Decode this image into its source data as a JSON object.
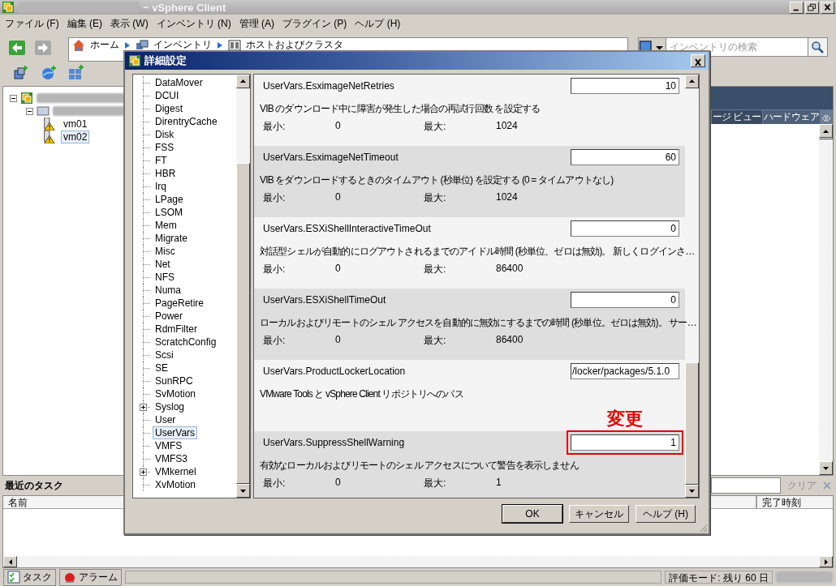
{
  "window": {
    "title": "~ vSphere Client"
  },
  "menu": [
    "ファイル (F)",
    "編集 (E)",
    "表示 (W)",
    "インベントリ (N)",
    "管理 (A)",
    "プラグイン (P)",
    "ヘルプ (H)"
  ],
  "breadcrumb": [
    "ホーム",
    "インベントリ",
    "ホストおよびクラスタ"
  ],
  "search": {
    "placeholder": "インベントリの検索"
  },
  "inventory_tree": [
    {
      "kind": "datacenter",
      "expanded": true,
      "children": [
        {
          "kind": "host",
          "expanded": true,
          "children": [
            {
              "kind": "vm",
              "label": "vm01",
              "selected": false
            },
            {
              "kind": "vm",
              "label": "vm02",
              "selected": true
            }
          ]
        }
      ]
    }
  ],
  "tabs": [
    {
      "label": "ージ ビュー",
      "selected": true
    },
    {
      "label": "ハードウェア",
      "selected": false
    }
  ],
  "recent_tasks": {
    "title": "最近のタスク",
    "clear": "クリア",
    "columns": [
      "名前",
      "完了時刻"
    ]
  },
  "status_bar": {
    "tabs": [
      "タスク",
      "アラーム"
    ],
    "mode": "評価モード: 残り 60 日"
  },
  "dialog": {
    "title": "詳細設定",
    "categories": [
      {
        "label": "DataMover",
        "kind": "leaf",
        "selected": false
      },
      {
        "label": "DCUI",
        "kind": "leaf",
        "selected": false
      },
      {
        "label": "Digest",
        "kind": "leaf",
        "selected": false
      },
      {
        "label": "DirentryCache",
        "kind": "leaf",
        "selected": false
      },
      {
        "label": "Disk",
        "kind": "leaf",
        "selected": false
      },
      {
        "label": "FSS",
        "kind": "leaf",
        "selected": false
      },
      {
        "label": "FT",
        "kind": "leaf",
        "selected": false
      },
      {
        "label": "HBR",
        "kind": "leaf",
        "selected": false
      },
      {
        "label": "Irq",
        "kind": "leaf",
        "selected": false
      },
      {
        "label": "LPage",
        "kind": "leaf",
        "selected": false
      },
      {
        "label": "LSOM",
        "kind": "leaf",
        "selected": false
      },
      {
        "label": "Mem",
        "kind": "leaf",
        "selected": false
      },
      {
        "label": "Migrate",
        "kind": "leaf",
        "selected": false
      },
      {
        "label": "Misc",
        "kind": "leaf",
        "selected": false
      },
      {
        "label": "Net",
        "kind": "leaf",
        "selected": false
      },
      {
        "label": "NFS",
        "kind": "leaf",
        "selected": false
      },
      {
        "label": "Numa",
        "kind": "leaf",
        "selected": false
      },
      {
        "label": "PageRetire",
        "kind": "leaf",
        "selected": false
      },
      {
        "label": "Power",
        "kind": "leaf",
        "selected": false
      },
      {
        "label": "RdmFilter",
        "kind": "leaf",
        "selected": false
      },
      {
        "label": "ScratchConfig",
        "kind": "leaf",
        "selected": false
      },
      {
        "label": "Scsi",
        "kind": "leaf",
        "selected": false
      },
      {
        "label": "SE",
        "kind": "leaf",
        "selected": false
      },
      {
        "label": "SunRPC",
        "kind": "leaf",
        "selected": false
      },
      {
        "label": "SvMotion",
        "kind": "leaf",
        "selected": false
      },
      {
        "label": "Syslog",
        "kind": "group",
        "expanded": false,
        "selected": false
      },
      {
        "label": "User",
        "kind": "leaf",
        "selected": false
      },
      {
        "label": "UserVars",
        "kind": "leaf",
        "selected": true
      },
      {
        "label": "VMFS",
        "kind": "leaf",
        "selected": false
      },
      {
        "label": "VMFS3",
        "kind": "leaf",
        "selected": false
      },
      {
        "label": "VMkernel",
        "kind": "group",
        "expanded": false,
        "selected": false
      },
      {
        "label": "XvMotion",
        "kind": "leaf",
        "selected": false
      }
    ],
    "settings": [
      {
        "name": "UserVars.EsximageNetRetries",
        "value": "10",
        "description": "VIB のダウンロード中に障害が発生した場合の再試行回数 を設定する",
        "min_label": "最小:",
        "min": "0",
        "max_label": "最大:",
        "max": "1024",
        "shaded": false,
        "highlighted": false
      },
      {
        "name": "UserVars.EsximageNetTimeout",
        "value": "60",
        "description": "VIB をダウンロードするときのタイムアウト (秒単位) を設定する (0 = タイムアウトなし)",
        "min_label": "最小:",
        "min": "0",
        "max_label": "最大:",
        "max": "1024",
        "shaded": true,
        "highlighted": false
      },
      {
        "name": "UserVars.ESXiShellInteractiveTimeOut",
        "value": "0",
        "description": "対話型シェルが自動的にログアウトされるまでのアイドル時間 (秒単位、ゼロは無効)。 新しくログインさ…",
        "min_label": "最小:",
        "min": "0",
        "max_label": "最大:",
        "max": "86400",
        "shaded": false,
        "highlighted": false
      },
      {
        "name": "UserVars.ESXiShellTimeOut",
        "value": "0",
        "description": "ローカルおよびリモートのシェル アクセスを自動的に無効にするまでの時間 (秒単位。ゼロは無効)。 サー…",
        "min_label": "最小:",
        "min": "0",
        "max_label": "最大:",
        "max": "86400",
        "shaded": true,
        "highlighted": false
      },
      {
        "name": "UserVars.ProductLockerLocation",
        "value": "/locker/packages/5.1.0",
        "description": "VMware Tools と vSphere Client リポジトリへのパス",
        "shaded": false,
        "highlighted": false
      },
      {
        "name": "UserVars.SuppressShellWarning",
        "value": "1",
        "description": "有効なローカルおよびリモートのシェル アクセスについて警告を表示しません",
        "min_label": "最小:",
        "min": "0",
        "max_label": "最大:",
        "max": "1",
        "shaded": true,
        "highlighted": true,
        "annotation": "変更"
      }
    ],
    "buttons": [
      {
        "label": "OK",
        "kind": "default"
      },
      {
        "label": "キャンセル",
        "kind": "normal"
      },
      {
        "label": "ヘルプ (H)",
        "kind": "normal"
      }
    ]
  }
}
